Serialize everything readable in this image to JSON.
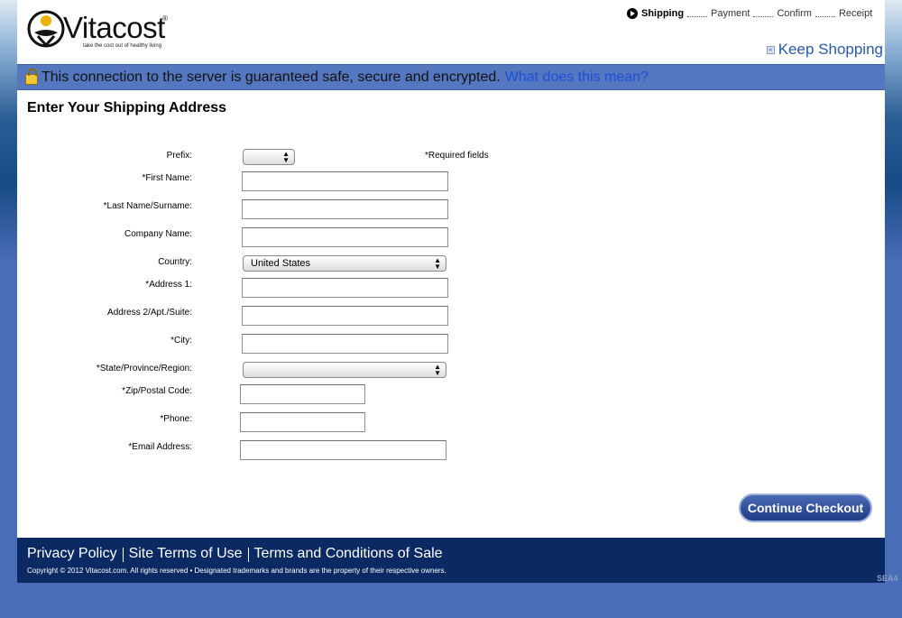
{
  "brand": {
    "name": "Vitacost",
    "registered": "®",
    "tagline": "take the cost out of healthy living"
  },
  "checkout_steps": [
    {
      "label": "Shipping",
      "active": true
    },
    {
      "label": "Payment",
      "active": false
    },
    {
      "label": "Confirm",
      "active": false
    },
    {
      "label": "Receipt",
      "active": false
    }
  ],
  "header": {
    "keep_shopping": "Keep Shopping"
  },
  "security": {
    "message": "This connection to the server is guaranteed safe, secure and encrypted.",
    "link": "What does this mean?"
  },
  "form": {
    "title": "Enter Your Shipping Address",
    "required_note": "*Required fields",
    "prefix": {
      "label": "Prefix:",
      "value": ""
    },
    "first_name": {
      "label": "*First Name:",
      "value": ""
    },
    "last_name": {
      "label": "*Last Name/Surname:",
      "value": ""
    },
    "company": {
      "label": "Company Name:",
      "value": ""
    },
    "country": {
      "label": "Country:",
      "value": "United States"
    },
    "address1": {
      "label": "*Address 1:",
      "value": ""
    },
    "address2": {
      "label": "Address 2/Apt./Suite:",
      "value": ""
    },
    "city": {
      "label": "*City:",
      "value": ""
    },
    "state": {
      "label": "*State/Province/Region:",
      "value": ""
    },
    "zip": {
      "label": "*Zip/Postal Code:",
      "value": ""
    },
    "phone": {
      "label": "*Phone:",
      "value": ""
    },
    "email": {
      "label": "*Email Address:",
      "value": ""
    },
    "continue_button": "Continue Checkout"
  },
  "footer": {
    "links": [
      "Privacy Policy",
      "Site Terms of Use",
      "Terms and Conditions of Sale"
    ],
    "copyright": "Copyright © 2012 Vitacost.com. All rights reserved • Designated trademarks and brands are the property of their respective owners."
  },
  "server_code": "SEA4",
  "colors": {
    "secure_bar": "#5577bf",
    "footer": "#0b2a63",
    "link": "#1b50d8",
    "button": "#1f3d86"
  }
}
